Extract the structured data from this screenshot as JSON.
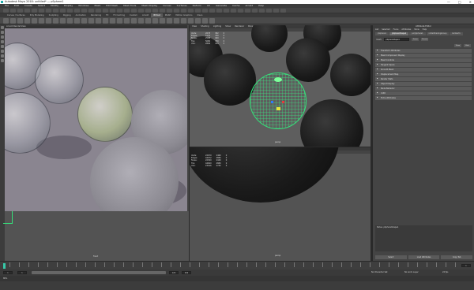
{
  "window": {
    "title": "Autodesk Maya 2018: untitled* — pSphere1",
    "controls": [
      "—",
      "□",
      "✕"
    ]
  },
  "menubar": [
    "File",
    "Edit",
    "Create",
    "Select",
    "Modify",
    "Display",
    "Windows",
    "Mesh",
    "Edit Mesh",
    "Mesh Tools",
    "Mesh Display",
    "Curves",
    "Surfaces",
    "Deform",
    "UV",
    "Generate",
    "Cache",
    "Arnold",
    "Help"
  ],
  "shelf_tabs": [
    "Curves / Surfaces",
    "Poly Modeling",
    "Sculpting",
    "Rigging",
    "Animation",
    "Rendering",
    "FX",
    "FX Caching",
    "Custom",
    "Arnold",
    "Bifrost",
    "MASH",
    "Motion Graphics",
    "XGen"
  ],
  "shelf_active_index": 10,
  "render_view": {
    "title": "Arnold RenderView"
  },
  "persp_view": {
    "menu": [
      "View",
      "Shading",
      "Lighting",
      "Show",
      "Renderer",
      "Panels"
    ],
    "hud": [
      {
        "label": "Verts:",
        "a": "2678",
        "b": "382",
        "c": "0"
      },
      {
        "label": "Edges:",
        "a": "5170",
        "b": "760",
        "c": "0"
      },
      {
        "label": "Faces:",
        "a": "2588",
        "b": "400",
        "c": "0"
      },
      {
        "label": "Tris:",
        "a": "5080",
        "b": "760",
        "c": "0"
      },
      {
        "label": "UVs:",
        "a": "2866",
        "b": "439",
        "c": "0"
      }
    ],
    "camera": "persp"
  },
  "bottom_view": {
    "menu": [
      "View",
      "Shading",
      "Lighting",
      "Show",
      "Renderer",
      "Panels"
    ],
    "hud": [
      {
        "label": "Verts:",
        "a": "22670",
        "b": "2460",
        "c": "0"
      },
      {
        "label": "Edges:",
        "a": "44972",
        "b": "4880",
        "c": "0"
      },
      {
        "label": "Faces:",
        "a": "22300",
        "b": "2440",
        "c": "0"
      },
      {
        "label": "Tris:",
        "a": "44600",
        "b": "4880",
        "c": "0"
      },
      {
        "label": "UVs:",
        "a": "23016",
        "b": "2745",
        "c": "0"
      }
    ],
    "camera": "persp"
  },
  "lower_left_view": {
    "camera": "front"
  },
  "attribute_editor": {
    "title": "Attribute Editor",
    "menu": [
      "List",
      "Selected",
      "Focus",
      "Attributes",
      "Show",
      "Help"
    ],
    "tabs": [
      "pSphere1",
      "pSphereShape1",
      "polySphere1",
      "initialShadingGroup",
      "lambert1"
    ],
    "active_tab": 1,
    "mesh_label": "mesh:",
    "mesh_value": "pSphereShape1",
    "focus_btn": "Focus",
    "presets_btn": "Presets",
    "show_btn": "Show",
    "hide_btn": "Hide",
    "sections": [
      "Transform Attributes",
      "Mesh Component Display",
      "Mesh Controls",
      "Tangent Space",
      "Smooth Mesh",
      "Displacement Map",
      "Render Stats",
      "Object Display",
      "Node Behavior",
      "UUID",
      "Extra Attributes"
    ],
    "notes_label": "Notes: pSphereShape1",
    "buttons": [
      "Select",
      "Load Attributes",
      "Copy Tab"
    ]
  },
  "time_slider": {
    "start": "1",
    "end": "120",
    "current": "1"
  },
  "range": {
    "start": "1",
    "end": "120",
    "max": "200"
  },
  "cmdline": {
    "label": "MEL"
  },
  "status": {
    "char_set": "No Character Set",
    "anim_layer": "No Anim Layer",
    "fps": "24 fps"
  },
  "colors": {
    "wireframe": "#35e07a",
    "bg": "#444444"
  }
}
